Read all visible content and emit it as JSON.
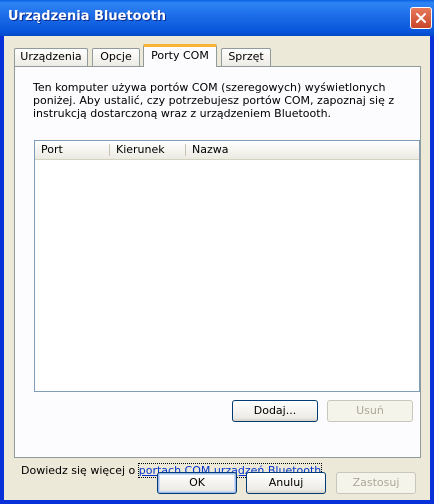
{
  "window": {
    "title": "Urządzenia Bluetooth"
  },
  "tabs": [
    {
      "label": "Urządzenia"
    },
    {
      "label": "Opcje"
    },
    {
      "label": "Porty COM",
      "active": true
    },
    {
      "label": "Sprzęt"
    }
  ],
  "panel": {
    "description": "Ten komputer używa portów COM (szeregowych) wyświetlonych poniżej. Aby ustalić, czy potrzebujesz portów COM, zapoznaj się z instrukcją dostarczoną wraz z urządzeniem Bluetooth.",
    "columns": [
      "Port",
      "Kierunek",
      "Nazwa"
    ],
    "rows": [],
    "add_label": "Dodaj...",
    "remove_label": "Usuń"
  },
  "learn_more": {
    "prefix": "Dowiedz się więcej o ",
    "link_text": "portach COM urządzeń Bluetooth",
    "suffix": "."
  },
  "footer": {
    "ok_label": "OK",
    "cancel_label": "Anuluj",
    "apply_label": "Zastosuj"
  },
  "colors": {
    "title_bar": "#0A58DF",
    "dialog_bg": "#ECE9D8",
    "active_tab_accent": "#F8B334",
    "link": "#0033CC"
  }
}
